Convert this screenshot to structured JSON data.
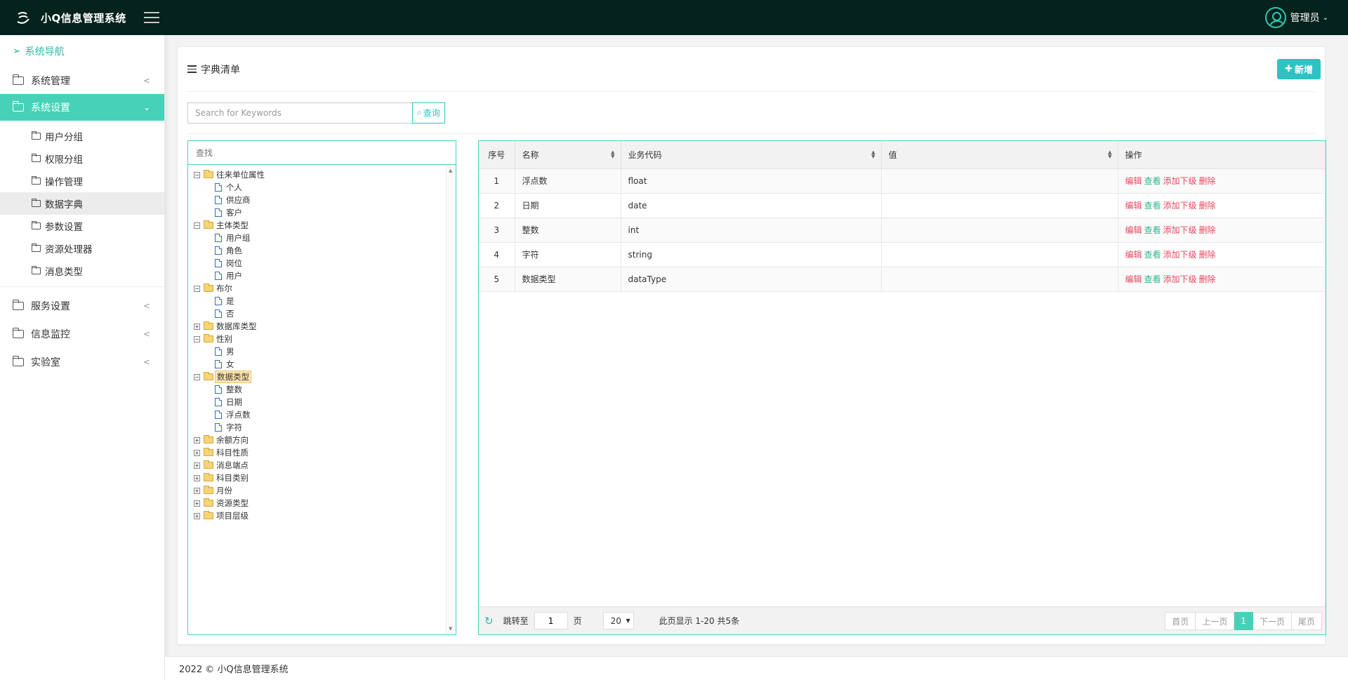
{
  "app": {
    "title": "小Q信息管理系统",
    "user": "管理员"
  },
  "sidebar": {
    "nav_title": "系统导航",
    "menus": [
      {
        "label": "系统管理"
      },
      {
        "label": "系统设置"
      },
      {
        "label": "服务设置"
      },
      {
        "label": "信息监控"
      },
      {
        "label": "实验室"
      }
    ],
    "sub_items": [
      "用户分组",
      "权限分组",
      "操作管理",
      "数据字典",
      "参数设置",
      "资源处理器",
      "消息类型"
    ]
  },
  "card": {
    "title": "字典清单",
    "add_label": "新增",
    "search_placeholder": "Search for Keywords",
    "query_label": "查询"
  },
  "tree": {
    "find_placeholder": "查找",
    "nodes": [
      "往来单位属性",
      "个人",
      "供应商",
      "客户",
      "主体类型",
      "用户组",
      "角色",
      "岗位",
      "用户",
      "布尔",
      "是",
      "否",
      "数据库类型",
      "性别",
      "男",
      "女",
      "数据类型",
      "整数",
      "日期",
      "浮点数",
      "字符",
      "余额方向",
      "科目性质",
      "消息端点",
      "科目类别",
      "月份",
      "资源类型",
      "项目层级"
    ]
  },
  "table": {
    "headers": [
      "序号",
      "名称",
      "业务代码",
      "值",
      "操作"
    ],
    "rows": [
      {
        "idx": "1",
        "name": "浮点数",
        "code": "float",
        "value": ""
      },
      {
        "idx": "2",
        "name": "日期",
        "code": "date",
        "value": ""
      },
      {
        "idx": "3",
        "name": "整数",
        "code": "int",
        "value": ""
      },
      {
        "idx": "4",
        "name": "字符",
        "code": "string",
        "value": ""
      },
      {
        "idx": "5",
        "name": "数据类型",
        "code": "dataType",
        "value": ""
      }
    ],
    "ops": {
      "edit": "编辑",
      "view": "查看",
      "add_child": "添加下级",
      "delete": "删除"
    }
  },
  "pager": {
    "goto_label": "跳转至",
    "goto_value": "1",
    "page_unit": "页",
    "page_size": "20",
    "info": "此页显示 1-20 共5条",
    "first": "首页",
    "prev": "上一页",
    "current": "1",
    "next": "下一页",
    "last": "尾页"
  },
  "footer": {
    "text": "2022 © 小Q信息管理系统"
  },
  "colors": {
    "accent": "#48d1b9",
    "topbar": "#06221c",
    "button": "#2dc3c3",
    "danger": "#e8475f",
    "success": "#2fb88a"
  }
}
